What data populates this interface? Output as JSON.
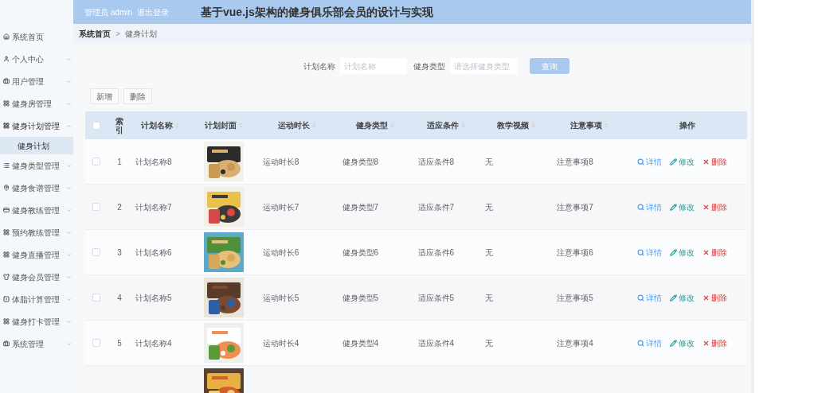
{
  "header": {
    "user": "管理员 admin",
    "logout": "退出登录",
    "title": "基于vue.js架构的健身俱乐部会员的设计与实现"
  },
  "sidebar": {
    "items": [
      {
        "label": "系统首页",
        "kind": "link"
      },
      {
        "label": "个人中心",
        "kind": "menu",
        "expanded": false
      },
      {
        "label": "用户管理",
        "kind": "menu",
        "expanded": false
      },
      {
        "label": "健身房管理",
        "kind": "menu",
        "expanded": false
      },
      {
        "label": "健身计划管理",
        "kind": "menu",
        "expanded": true,
        "children": [
          {
            "label": "健身计划",
            "selected": true
          }
        ]
      },
      {
        "label": "健身类型管理",
        "kind": "menu",
        "expanded": false
      },
      {
        "label": "健身食谱管理",
        "kind": "menu",
        "expanded": false
      },
      {
        "label": "健身教练管理",
        "kind": "menu",
        "expanded": false
      },
      {
        "label": "预约教练管理",
        "kind": "menu",
        "expanded": false
      },
      {
        "label": "健身直播管理",
        "kind": "menu",
        "expanded": false
      },
      {
        "label": "健身会员管理",
        "kind": "menu",
        "expanded": false
      },
      {
        "label": "体脂计算管理",
        "kind": "menu",
        "expanded": false
      },
      {
        "label": "健身打卡管理",
        "kind": "menu",
        "expanded": false
      },
      {
        "label": "系统管理",
        "kind": "menu",
        "expanded": false
      }
    ]
  },
  "breadcrumb": {
    "items": [
      "系统首页",
      "健身计划"
    ],
    "separator": ">"
  },
  "search": {
    "fields": [
      {
        "label": "计划名称",
        "placeholder": "计划名称",
        "kind": "input"
      },
      {
        "label": "健身类型",
        "placeholder": "请选择健身类型",
        "kind": "select"
      }
    ],
    "button": "查询"
  },
  "toolbar": [
    "新增",
    "删除"
  ],
  "table": {
    "select_all": false,
    "columns": [
      {
        "label": "索引",
        "sortable": false
      },
      {
        "label": "计划名称",
        "sortable": true
      },
      {
        "label": "计划封面",
        "sortable": true
      },
      {
        "label": "运动时长",
        "sortable": true
      },
      {
        "label": "健身类型",
        "sortable": true
      },
      {
        "label": "适应条件",
        "sortable": true
      },
      {
        "label": "教学视频",
        "sortable": true
      },
      {
        "label": "注意事项",
        "sortable": true
      },
      {
        "label": "操作",
        "sortable": false
      }
    ],
    "rows": [
      {
        "selected": false,
        "index": "1",
        "name": "计划名称8",
        "cover": {
          "kind": "picture"
        },
        "duration": "运动时长8",
        "type": "健身类型8",
        "condition": "适应条件8",
        "video": "无",
        "notes": "注意事项8",
        "actions": [
          {
            "kind": "view",
            "label": "详情"
          },
          {
            "kind": "edit",
            "label": "修改"
          },
          {
            "kind": "delete",
            "label": "删除"
          }
        ]
      },
      {
        "selected": false,
        "index": "2",
        "name": "计划名称7",
        "cover": {
          "kind": "picture"
        },
        "duration": "运动时长7",
        "type": "健身类型7",
        "condition": "适应条件7",
        "video": "无",
        "notes": "注意事项7",
        "actions": [
          {
            "kind": "view",
            "label": "详情"
          },
          {
            "kind": "edit",
            "label": "修改"
          },
          {
            "kind": "delete",
            "label": "删除"
          }
        ]
      },
      {
        "selected": false,
        "index": "3",
        "name": "计划名称6",
        "cover": {
          "kind": "picture"
        },
        "duration": "运动时长6",
        "type": "健身类型6",
        "condition": "适应条件6",
        "video": "无",
        "notes": "注意事项6",
        "actions": [
          {
            "kind": "view",
            "label": "详情"
          },
          {
            "kind": "edit",
            "label": "修改"
          },
          {
            "kind": "delete",
            "label": "删除"
          }
        ]
      },
      {
        "selected": false,
        "index": "4",
        "name": "计划名称5",
        "cover": {
          "kind": "picture"
        },
        "duration": "运动时长5",
        "type": "健身类型5",
        "condition": "适应条件5",
        "video": "无",
        "notes": "注意事项5",
        "actions": [
          {
            "kind": "view",
            "label": "详情"
          },
          {
            "kind": "edit",
            "label": "修改"
          },
          {
            "kind": "delete",
            "label": "删除"
          }
        ]
      },
      {
        "selected": false,
        "index": "5",
        "name": "计划名称4",
        "cover": {
          "kind": "picture"
        },
        "duration": "运动时长4",
        "type": "健身类型4",
        "condition": "适应条件4",
        "video": "无",
        "notes": "注意事项4",
        "actions": [
          {
            "kind": "view",
            "label": "详情"
          },
          {
            "kind": "edit",
            "label": "修改"
          },
          {
            "kind": "delete",
            "label": "删除"
          }
        ]
      },
      {
        "cover": {
          "kind": "picture"
        }
      }
    ]
  }
}
